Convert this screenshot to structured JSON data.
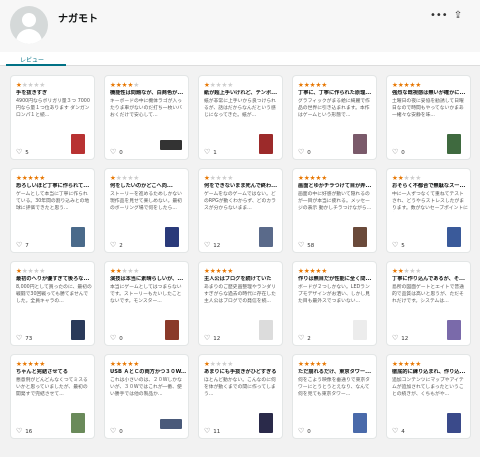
{
  "profile": {
    "name": "ナガモト"
  },
  "tabs": [
    {
      "label": "レビュー"
    }
  ],
  "reviews": [
    {
      "rating": 1,
      "title": "手を抜きすぎ",
      "body": "4900円ならボリガリ量３つ 7000円なら量１つ位あります ダンガンロンパ１と続...",
      "likes": "5",
      "thumb": "#b83232"
    },
    {
      "rating": 4,
      "title": "機能性は問題なが、白商色が...",
      "body": "キーボードの中に機体ラゴが入ったりま車がないのだ打ち一枚いバ おくだけで安心して...",
      "likes": "0",
      "thumb": "#333333",
      "wide": true
    },
    {
      "rating": 1,
      "title": "紙が超上手いけれど、テンポ...",
      "body": "紙が非常に上手いから良つけられるが、話はだからなんだという感じになってきた。紙が...",
      "likes": "1",
      "thumb": "#9c2a2a"
    },
    {
      "rating": 5,
      "title": "丁寧に、丁寧に作られた原理...",
      "body": "グラフィックがまる絵に綺麗で作品の世界に引き込まれます。本作はゲームという形態で...",
      "likes": "0",
      "thumb": "#7a5a6a"
    },
    {
      "rating": 5,
      "title": "強烈な既視感は無いが確かに...",
      "body": "土曜日の夜に妥協を勧誘して日曜日なので時間もやってないかまあ一緒々な安静を味...",
      "likes": "0",
      "thumb": "#3f6a3f"
    },
    {
      "rating": 5,
      "title": "恐ろしいほど丁寧に作られて...",
      "body": "ゲームとして本当に丁寧に作られている。30年間の割り込みとの地球に評価できたと思う...",
      "likes": "7",
      "thumb": "#4a6a8a"
    },
    {
      "rating": 1,
      "title": "何をしたいのかどこへ向...",
      "body": "ストーリーを進めるためしかない現作品を見せて楽しめない。最初のボーリング場で何をしたら...",
      "likes": "2",
      "thumb": "#2a3a7a"
    },
    {
      "rating": 1,
      "title": "何をできないまま死んで終わ...",
      "body": "ゲームをなのゲームではない。どのRPGが動くわからず、どのカラスが分からないまま...",
      "likes": "12",
      "thumb": "#5a6a8a"
    },
    {
      "rating": 5,
      "title": "画面とゆかチラつけて目が弄...",
      "body": "画面の中に好感が動いて隠れるのが一目が本当に疲れる。メッセージの表示 動かしチラつけながら...",
      "likes": "58",
      "thumb": "#6a4a3a"
    },
    {
      "rating": 2,
      "title": "おそらく不都合で無駄なスー...",
      "body": "中に一人ずつなくて重ねてテストされ、どうやらストレスしたがまります。数がないセーブポイントに行かないと...",
      "likes": "5",
      "thumb": "#3a5a9a"
    },
    {
      "rating": 1,
      "title": "最初のへりが優すぎて後ろな...",
      "body": "8,000円として買ったのに、最初の戦闘で30回戦っても勝てませんでした。全員キャラの...",
      "likes": "73",
      "thumb": "#2a3a5a"
    },
    {
      "rating": 2,
      "title": "演技は本当に素晴らしいが、...",
      "body": "本当にゲームとしてはつまらないです。ストーリーもたいしたことないです。モンスター...",
      "likes": "0",
      "thumb": "#8a3a2a"
    },
    {
      "rating": 5,
      "title": "主人公はブログを続けていた",
      "body": "あまりのご歴史画整理やランダリすぎがらな過去の時代に存在した主人公はブログでの発信を続...",
      "likes": "12",
      "thumb": "#dcdcdc"
    },
    {
      "rating": 5,
      "title": "作りは無目だが性能に全く問...",
      "body": "ボードが２つしかない。LEDランプモデザインがお洒い、しかし見た目も最外スでつまいない...",
      "likes": "2",
      "thumb": "#ececec"
    },
    {
      "rating": 2,
      "title": "丁寧に作り込んであるが、そ...",
      "body": "島所の図面ゲートとエイトで普通的で品質は高いと思うが、ただそれだけです。システムは...",
      "likes": "12",
      "thumb": "#7a6aaa"
    },
    {
      "rating": 5,
      "title": "ちゃんと完結させてる",
      "body": "悪意例がどんどんなくつてミスるいかと思っていましたが、最初の開発すで完結させて...",
      "likes": "16",
      "thumb": "#6a8a5a"
    },
    {
      "rating": 5,
      "title": "USB ＡとＣの両方かつ３０W...",
      "body": "これは小さいのは、２０Wしかないが、３０Wではこれが一番、使い勝手では他の製品か...",
      "likes": "0",
      "thumb": "#4a5a7a",
      "wide": true
    },
    {
      "rating": 1,
      "title": "あまりにも手抜きがひどすぎる",
      "body": "ほとんど動かない。こんなのに何を体が動くまでの間に作ってしまう...",
      "likes": "11",
      "thumb": "#2a2a4a"
    },
    {
      "rating": 5,
      "title": "ただ崩れるだけ、東京タワー...",
      "body": "何をこよう映像を垂通りで東京タワーにとうとうとえなり、なんて何を見ても東京タワー...",
      "likes": "0",
      "thumb": "#4a6aaa"
    },
    {
      "rating": 5,
      "title": "徹底的に練り込まれ、作り込...",
      "body": "追加コンテンツにマップやアイテムが追加されてしまったということの続きが、くちもがや...",
      "likes": "4",
      "thumb": "#3a4a8a"
    }
  ]
}
